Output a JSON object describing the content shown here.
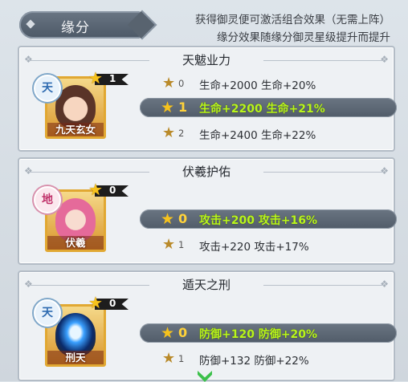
{
  "header": {
    "tab_label": "缘分",
    "hint_line1": "获得御灵便可激活组合效果（无需上阵）",
    "hint_line2": "缘分效果随缘分御灵星级提升而提升"
  },
  "cards": [
    {
      "title": "天魃业力",
      "element": "天",
      "stars": "1",
      "portrait_name": "九天玄女",
      "rows": [
        {
          "level": "0",
          "text": "生命+2000 生命+20%",
          "active": false
        },
        {
          "level": "1",
          "text": "生命+2200 生命+21%",
          "active": true
        },
        {
          "level": "2",
          "text": "生命+2400 生命+22%",
          "active": false
        }
      ]
    },
    {
      "title": "伏羲护佑",
      "element": "地",
      "stars": "0",
      "portrait_name": "伏羲",
      "rows": [
        {
          "level": "0",
          "text": "攻击+200 攻击+16%",
          "active": true
        },
        {
          "level": "1",
          "text": "攻击+220 攻击+17%",
          "active": false
        }
      ]
    },
    {
      "title": "遁天之刑",
      "element": "天",
      "stars": "0",
      "portrait_name": "刑天",
      "rows": [
        {
          "level": "0",
          "text": "防御+120 防御+20%",
          "active": true
        },
        {
          "level": "1",
          "text": "防御+132 防御+22%",
          "active": false
        }
      ]
    }
  ],
  "icons": {
    "star": "star-icon",
    "more": "chevron-down-icon"
  },
  "colors": {
    "active_text": "#b9f51c",
    "star": "#f6c21c",
    "frame_gold": "#e1a832"
  }
}
